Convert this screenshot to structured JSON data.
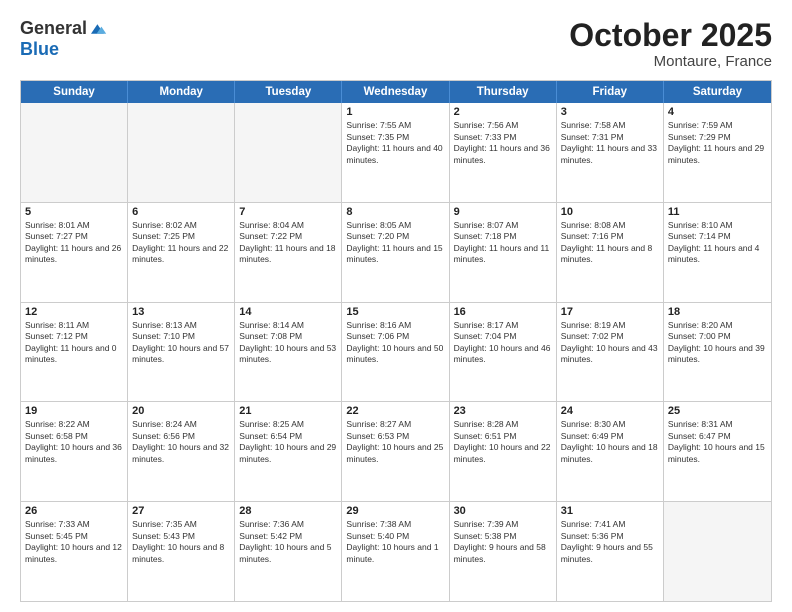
{
  "header": {
    "logo_general": "General",
    "logo_blue": "Blue",
    "month_title": "October 2025",
    "location": "Montaure, France"
  },
  "calendar": {
    "days_of_week": [
      "Sunday",
      "Monday",
      "Tuesday",
      "Wednesday",
      "Thursday",
      "Friday",
      "Saturday"
    ],
    "rows": [
      [
        {
          "day": "",
          "empty": true
        },
        {
          "day": "",
          "empty": true
        },
        {
          "day": "",
          "empty": true
        },
        {
          "day": "1",
          "sunrise": "Sunrise: 7:55 AM",
          "sunset": "Sunset: 7:35 PM",
          "daylight": "Daylight: 11 hours and 40 minutes."
        },
        {
          "day": "2",
          "sunrise": "Sunrise: 7:56 AM",
          "sunset": "Sunset: 7:33 PM",
          "daylight": "Daylight: 11 hours and 36 minutes."
        },
        {
          "day": "3",
          "sunrise": "Sunrise: 7:58 AM",
          "sunset": "Sunset: 7:31 PM",
          "daylight": "Daylight: 11 hours and 33 minutes."
        },
        {
          "day": "4",
          "sunrise": "Sunrise: 7:59 AM",
          "sunset": "Sunset: 7:29 PM",
          "daylight": "Daylight: 11 hours and 29 minutes."
        }
      ],
      [
        {
          "day": "5",
          "sunrise": "Sunrise: 8:01 AM",
          "sunset": "Sunset: 7:27 PM",
          "daylight": "Daylight: 11 hours and 26 minutes."
        },
        {
          "day": "6",
          "sunrise": "Sunrise: 8:02 AM",
          "sunset": "Sunset: 7:25 PM",
          "daylight": "Daylight: 11 hours and 22 minutes."
        },
        {
          "day": "7",
          "sunrise": "Sunrise: 8:04 AM",
          "sunset": "Sunset: 7:22 PM",
          "daylight": "Daylight: 11 hours and 18 minutes."
        },
        {
          "day": "8",
          "sunrise": "Sunrise: 8:05 AM",
          "sunset": "Sunset: 7:20 PM",
          "daylight": "Daylight: 11 hours and 15 minutes."
        },
        {
          "day": "9",
          "sunrise": "Sunrise: 8:07 AM",
          "sunset": "Sunset: 7:18 PM",
          "daylight": "Daylight: 11 hours and 11 minutes."
        },
        {
          "day": "10",
          "sunrise": "Sunrise: 8:08 AM",
          "sunset": "Sunset: 7:16 PM",
          "daylight": "Daylight: 11 hours and 8 minutes."
        },
        {
          "day": "11",
          "sunrise": "Sunrise: 8:10 AM",
          "sunset": "Sunset: 7:14 PM",
          "daylight": "Daylight: 11 hours and 4 minutes."
        }
      ],
      [
        {
          "day": "12",
          "sunrise": "Sunrise: 8:11 AM",
          "sunset": "Sunset: 7:12 PM",
          "daylight": "Daylight: 11 hours and 0 minutes."
        },
        {
          "day": "13",
          "sunrise": "Sunrise: 8:13 AM",
          "sunset": "Sunset: 7:10 PM",
          "daylight": "Daylight: 10 hours and 57 minutes."
        },
        {
          "day": "14",
          "sunrise": "Sunrise: 8:14 AM",
          "sunset": "Sunset: 7:08 PM",
          "daylight": "Daylight: 10 hours and 53 minutes."
        },
        {
          "day": "15",
          "sunrise": "Sunrise: 8:16 AM",
          "sunset": "Sunset: 7:06 PM",
          "daylight": "Daylight: 10 hours and 50 minutes."
        },
        {
          "day": "16",
          "sunrise": "Sunrise: 8:17 AM",
          "sunset": "Sunset: 7:04 PM",
          "daylight": "Daylight: 10 hours and 46 minutes."
        },
        {
          "day": "17",
          "sunrise": "Sunrise: 8:19 AM",
          "sunset": "Sunset: 7:02 PM",
          "daylight": "Daylight: 10 hours and 43 minutes."
        },
        {
          "day": "18",
          "sunrise": "Sunrise: 8:20 AM",
          "sunset": "Sunset: 7:00 PM",
          "daylight": "Daylight: 10 hours and 39 minutes."
        }
      ],
      [
        {
          "day": "19",
          "sunrise": "Sunrise: 8:22 AM",
          "sunset": "Sunset: 6:58 PM",
          "daylight": "Daylight: 10 hours and 36 minutes."
        },
        {
          "day": "20",
          "sunrise": "Sunrise: 8:24 AM",
          "sunset": "Sunset: 6:56 PM",
          "daylight": "Daylight: 10 hours and 32 minutes."
        },
        {
          "day": "21",
          "sunrise": "Sunrise: 8:25 AM",
          "sunset": "Sunset: 6:54 PM",
          "daylight": "Daylight: 10 hours and 29 minutes."
        },
        {
          "day": "22",
          "sunrise": "Sunrise: 8:27 AM",
          "sunset": "Sunset: 6:53 PM",
          "daylight": "Daylight: 10 hours and 25 minutes."
        },
        {
          "day": "23",
          "sunrise": "Sunrise: 8:28 AM",
          "sunset": "Sunset: 6:51 PM",
          "daylight": "Daylight: 10 hours and 22 minutes."
        },
        {
          "day": "24",
          "sunrise": "Sunrise: 8:30 AM",
          "sunset": "Sunset: 6:49 PM",
          "daylight": "Daylight: 10 hours and 18 minutes."
        },
        {
          "day": "25",
          "sunrise": "Sunrise: 8:31 AM",
          "sunset": "Sunset: 6:47 PM",
          "daylight": "Daylight: 10 hours and 15 minutes."
        }
      ],
      [
        {
          "day": "26",
          "sunrise": "Sunrise: 7:33 AM",
          "sunset": "Sunset: 5:45 PM",
          "daylight": "Daylight: 10 hours and 12 minutes."
        },
        {
          "day": "27",
          "sunrise": "Sunrise: 7:35 AM",
          "sunset": "Sunset: 5:43 PM",
          "daylight": "Daylight: 10 hours and 8 minutes."
        },
        {
          "day": "28",
          "sunrise": "Sunrise: 7:36 AM",
          "sunset": "Sunset: 5:42 PM",
          "daylight": "Daylight: 10 hours and 5 minutes."
        },
        {
          "day": "29",
          "sunrise": "Sunrise: 7:38 AM",
          "sunset": "Sunset: 5:40 PM",
          "daylight": "Daylight: 10 hours and 1 minute."
        },
        {
          "day": "30",
          "sunrise": "Sunrise: 7:39 AM",
          "sunset": "Sunset: 5:38 PM",
          "daylight": "Daylight: 9 hours and 58 minutes."
        },
        {
          "day": "31",
          "sunrise": "Sunrise: 7:41 AM",
          "sunset": "Sunset: 5:36 PM",
          "daylight": "Daylight: 9 hours and 55 minutes."
        },
        {
          "day": "",
          "empty": true
        }
      ]
    ]
  }
}
